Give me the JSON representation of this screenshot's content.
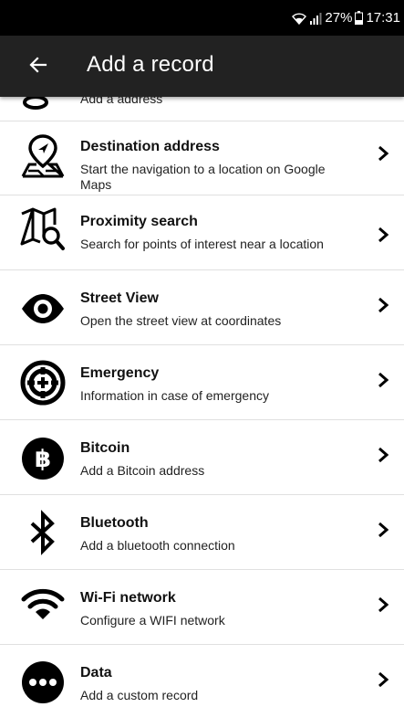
{
  "status_bar": {
    "battery": "27%",
    "time": "17:31",
    "icons": [
      "wifi-icon",
      "signal-icon",
      "battery-icon"
    ]
  },
  "app_bar": {
    "title": "Add a record",
    "back_icon": "arrow-left-icon"
  },
  "list": {
    "partial_item": {
      "description": "Add a address",
      "icon": "map-pin-icon"
    },
    "items": [
      {
        "title": "Destination address",
        "description": "Start the navigation to a location on Google Maps",
        "icon": "map-location-icon"
      },
      {
        "title": "Proximity search",
        "description": "Search for points of interest near a location",
        "icon": "map-search-icon"
      },
      {
        "title": "Street View",
        "description": "Open the street view at coordinates",
        "icon": "eye-icon"
      },
      {
        "title": "Emergency",
        "description": "Information in case of emergency",
        "icon": "lifebuoy-icon"
      },
      {
        "title": "Bitcoin",
        "description": "Add a Bitcoin address",
        "icon": "bitcoin-icon"
      },
      {
        "title": "Bluetooth",
        "description": "Add a bluetooth connection",
        "icon": "bluetooth-icon"
      },
      {
        "title": "Wi-Fi network",
        "description": "Configure a WIFI network",
        "icon": "wifi-icon"
      },
      {
        "title": "Data",
        "description": "Add a custom record",
        "icon": "more-dots-icon"
      }
    ]
  }
}
